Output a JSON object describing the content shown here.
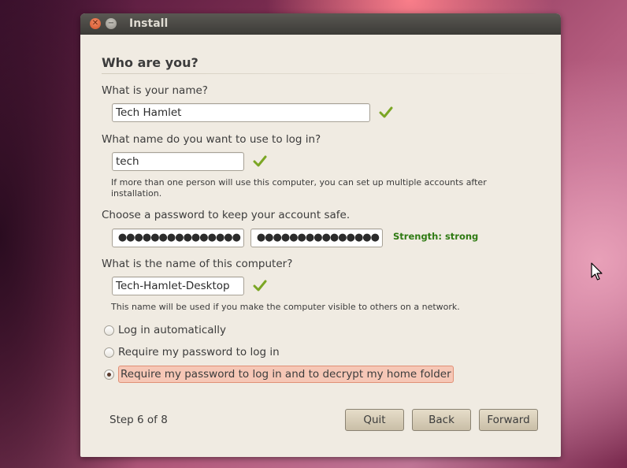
{
  "window": {
    "title": "Install"
  },
  "page": {
    "heading": "Who are you?",
    "name": {
      "label": "What is your name?",
      "value": "Tech Hamlet"
    },
    "username": {
      "label": "What name do you want to use to log in?",
      "value": "tech",
      "note": "If more than one person will use this computer, you can set up multiple accounts after installation."
    },
    "password": {
      "label": "Choose a password to keep your account safe.",
      "value": "●●●●●●●●●●●●●●●",
      "confirm_value": "●●●●●●●●●●●●●●●",
      "strength": "Strength: strong"
    },
    "computer": {
      "label": "What is the name of this computer?",
      "value": "Tech-Hamlet-Desktop",
      "note": "This name will be used if you make the computer visible to others on a network."
    },
    "login_options": [
      {
        "label": "Log in automatically",
        "selected": false
      },
      {
        "label": "Require my password to log in",
        "selected": false
      },
      {
        "label": "Require my password to log in and to decrypt my home folder",
        "selected": true
      }
    ]
  },
  "footer": {
    "step": "Step 6 of 8",
    "quit": "Quit",
    "back": "Back",
    "forward": "Forward"
  },
  "colors": {
    "accent": "#2e7a12",
    "selection": "#f6c7b6",
    "titlebar": "#3c3b37"
  },
  "icons": [
    "close-icon",
    "minimize-icon",
    "checkmark-icon",
    "mouse-pointer-icon"
  ]
}
